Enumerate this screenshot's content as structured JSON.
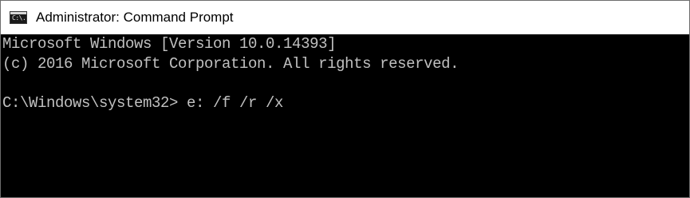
{
  "window": {
    "title": "Administrator: Command Prompt",
    "icon": "command-prompt-icon",
    "icon_glyph": "C:\\."
  },
  "console": {
    "lines": [
      "Microsoft Windows [Version 10.0.14393]",
      "(c) 2016 Microsoft Corporation. All rights reserved.",
      "",
      "C:\\Windows\\system32> e: /f /r /x"
    ],
    "text_color": "#c0c0c0",
    "background_color": "#000000"
  }
}
